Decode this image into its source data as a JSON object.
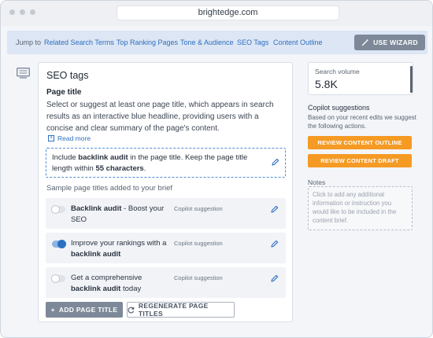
{
  "browser": {
    "url": "brightedge.com"
  },
  "jump_nav": {
    "label": "Jump to",
    "links": [
      "Related Search Terms",
      "Top Ranking Pages",
      "Tone & Audience",
      "SEO Tags",
      "Content Outline"
    ],
    "wizard_button": "USE WIZARD"
  },
  "seo_card": {
    "title": "SEO tags",
    "section_title": "Page title",
    "description": "Select or suggest at least one page title, which appears in search results as an interactive blue headline, providing users with a concise and clear summary of the page's content.",
    "read_more": "Read more",
    "hint": {
      "prefix": "Include ",
      "keyword": "backlink audit",
      "middle": " in the page title. Keep the page title length within ",
      "limit": "55 characters",
      "suffix": "."
    },
    "samples_heading": "Sample page titles added to your brief",
    "samples": [
      {
        "bold_part": "Backlink audit",
        "rest": " - Boost your SEO",
        "tag": "Copilot suggestion",
        "enabled": false
      },
      {
        "lead": "Improve your rankings with a ",
        "bold_part": "backlink audit",
        "tag": "Copilot suggestion",
        "enabled": true
      },
      {
        "lead": "Get a comprehensive ",
        "bold_part": "backlink audit",
        "rest": " today",
        "tag": "Copilot suggestion",
        "enabled": false
      }
    ],
    "add_button": "ADD PAGE TITLE",
    "regen_button": "REGENERATE PAGE TITLES"
  },
  "sidebar": {
    "volume_label": "Search volume",
    "volume_value": "5.8K",
    "copilot_heading": "Copilot suggestions",
    "copilot_desc": "Based on your recent edits we suggest the following actions.",
    "actions": [
      "REVIEW CONTENT OUTLINE",
      "REVIEW CONTENT DRAFT"
    ],
    "notes_label": "Notes",
    "notes_placeholder": "Click to add any additional information or instruction you would like to be included in the content brief."
  },
  "colors": {
    "accent_blue": "#2d6fc1",
    "orange": "#f59a23",
    "gray_button": "#7d8898"
  },
  "icons": [
    "pencil-icon",
    "wand-icon",
    "plus-icon",
    "refresh-icon",
    "document-icon"
  ]
}
